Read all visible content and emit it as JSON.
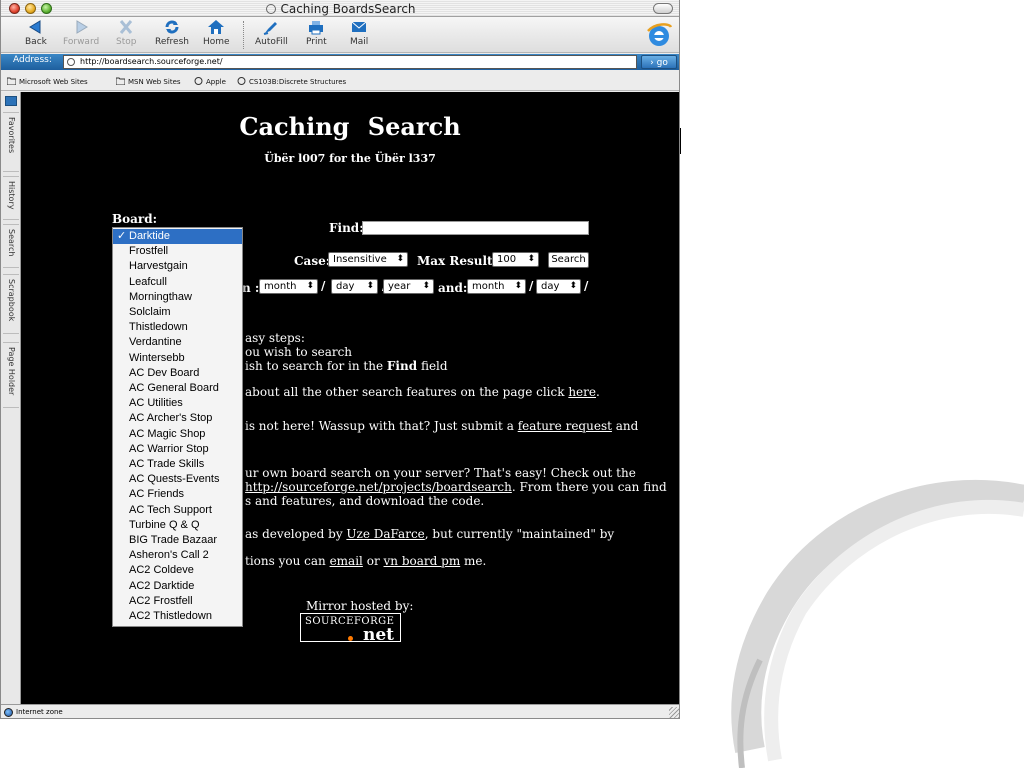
{
  "window": {
    "title": "Caching BoardsSearch"
  },
  "toolbar": {
    "buttons": [
      {
        "label": "Back",
        "icon": "back-arrow-icon"
      },
      {
        "label": "Forward",
        "icon": "forward-arrow-icon"
      },
      {
        "label": "Stop",
        "icon": "stop-icon"
      },
      {
        "label": "Refresh",
        "icon": "refresh-icon"
      },
      {
        "label": "Home",
        "icon": "home-icon"
      },
      {
        "label": "AutoFill",
        "icon": "autofill-icon"
      },
      {
        "label": "Print",
        "icon": "printer-icon"
      },
      {
        "label": "Mail",
        "icon": "mail-icon"
      }
    ]
  },
  "address": {
    "label": "Address:",
    "url": "http://boardsearch.sourceforge.net/",
    "go_label": "go"
  },
  "favorites": [
    {
      "label": "Microsoft Web Sites"
    },
    {
      "label": "MSN Web Sites"
    },
    {
      "label": "Apple"
    },
    {
      "label": "CS103B:Discrete Structures"
    }
  ],
  "sidebar_tabs": [
    "Favorites",
    "History",
    "Search",
    "Scrapbook",
    "Page Holder"
  ],
  "page": {
    "title": "Caching   Search",
    "subtitle": "Übër l007 for the Übër l337",
    "board_label": "Board:",
    "find_label": "Find:",
    "find_value": "",
    "case_label": "Case:",
    "case_value": "Insensitive",
    "max_results_label": "Max Results:",
    "max_results_value": "100",
    "search_button": "Search",
    "between_fragment": "n :",
    "and_label": "and:",
    "date_from": {
      "month": "month",
      "day": "day",
      "year": "year"
    },
    "date_to": {
      "month": "month",
      "day": "day"
    },
    "slash": "/",
    "steps_intro_fragment": "asy steps:",
    "step1_fragment": "ou wish to search",
    "step2_fragment": "ish to search for in the",
    "step2_bold": "Find",
    "step2_tail": "field",
    "features_fragment": "about all the other search features on the page click",
    "features_link": "here",
    "missing_fragment": "is not here! Wassup with that? Just submit a",
    "feature_request_link": "feature request",
    "missing_tail": "and",
    "own_fragment": "ur own board search on your server? That's easy! Check out the",
    "project_link": "http://sourceforge.net/projects/boardsearch",
    "project_tail": ". From there you can find",
    "features_code_fragment": "s and features, and download the code.",
    "dev_fragment": "as developed by",
    "dev_link": "Uze DaFarce",
    "dev_tail": ", but currently \"maintained\" by",
    "questions_fragment": "tions you can",
    "email_link": "email",
    "or_text": "or",
    "pm_link": "vn board pm",
    "me_text": "me.",
    "mirror_label": "Mirror hosted by:",
    "sf_text_1": "SOURCEFORGE",
    "sf_text_2": "net"
  },
  "board_dropdown": {
    "selected": "Darktide",
    "check": "✓",
    "options": [
      "Darktide",
      "Frostfell",
      "Harvestgain",
      "Leafcull",
      "Morningthaw",
      "Solclaim",
      "Thistledown",
      "Verdantine",
      "Wintersebb",
      "AC Dev Board",
      "AC General Board",
      "AC Utilities",
      "AC Archer's Stop",
      "AC Magic Shop",
      "AC Warrior Stop",
      "AC Trade Skills",
      "AC Quests-Events",
      "AC Friends",
      "AC Tech Support",
      "Turbine Q & Q",
      "BIG Trade Bazaar",
      "Asheron's Call 2",
      "AC2 Coldeve",
      "AC2 Darktide",
      "AC2 Frostfell",
      "AC2 Thistledown"
    ]
  },
  "status": {
    "zone": "Internet zone"
  },
  "colors": {
    "page_bg": "#000000",
    "highlight": "#2d6fc4",
    "address_bar": "#1e5f9e"
  }
}
